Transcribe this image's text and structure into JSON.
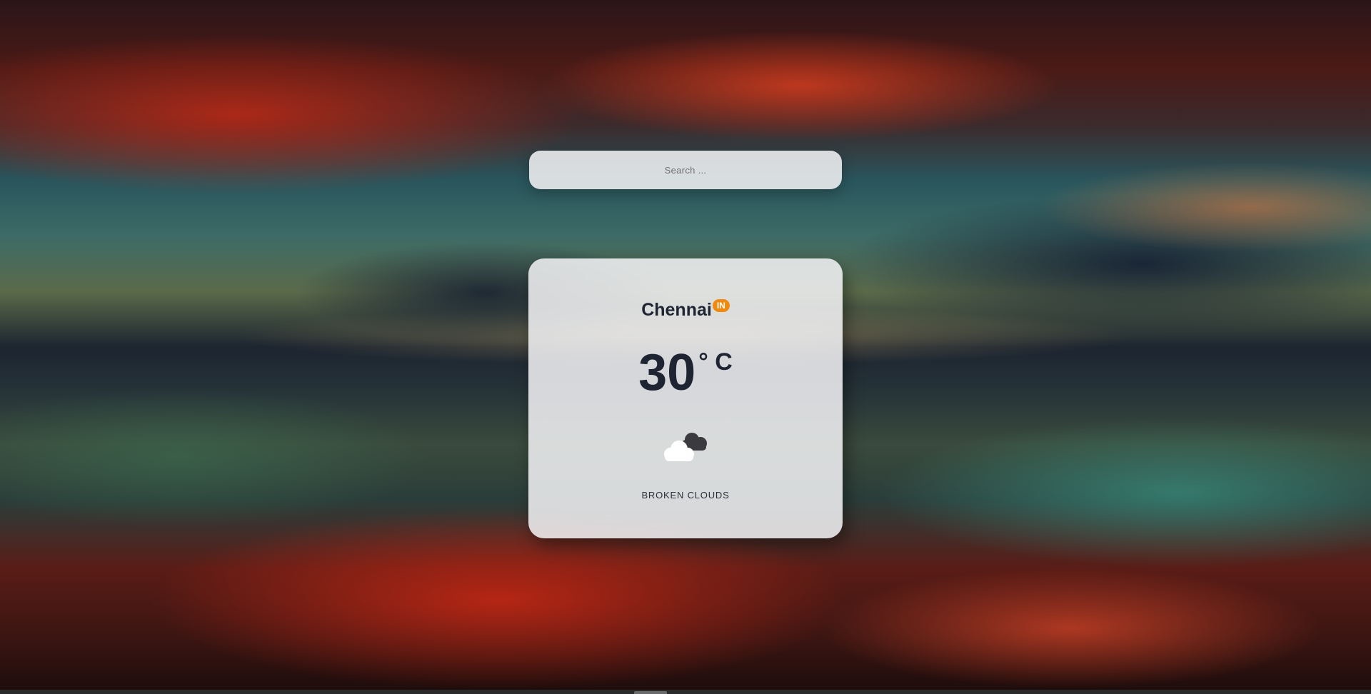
{
  "search": {
    "placeholder": "Search ..."
  },
  "weather": {
    "city": "Chennai",
    "country": "IN",
    "temperature": "30",
    "unit": "° C",
    "icon": "broken-clouds-icon",
    "description": "BROKEN CLOUDS"
  },
  "colors": {
    "badge": "#ef8a0e",
    "text": "#1f2433",
    "card": "#f3f3f6"
  }
}
